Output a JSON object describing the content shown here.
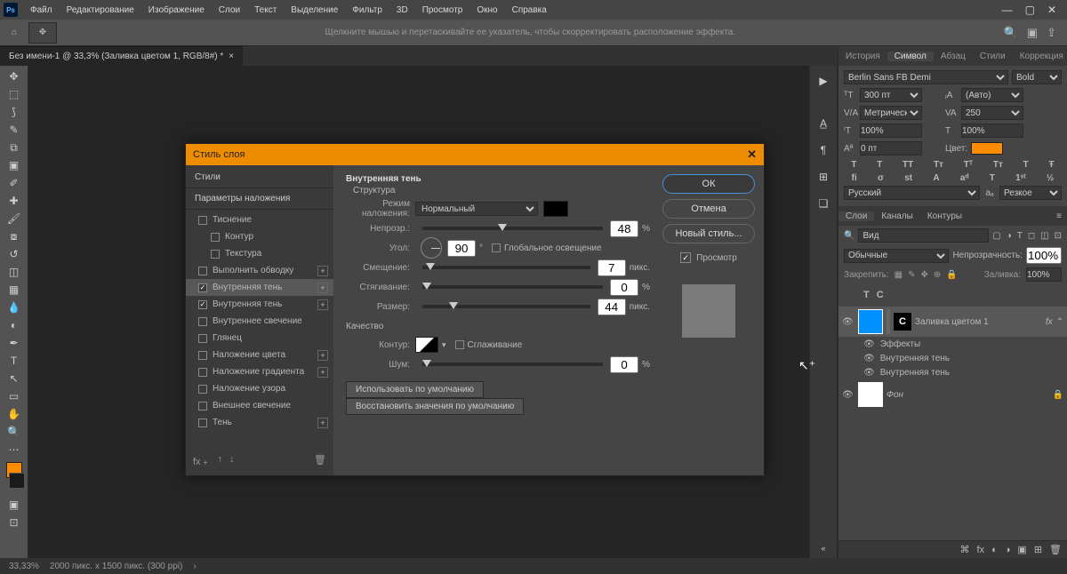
{
  "menu": {
    "items": [
      "Файл",
      "Редактирование",
      "Изображение",
      "Слои",
      "Текст",
      "Выделение",
      "Фильтр",
      "3D",
      "Просмотр",
      "Окно",
      "Справка"
    ]
  },
  "toolbar": {
    "hint": "Щелкните мышью и перетаскивайте ее указатель, чтобы скорректировать расположение эффекта."
  },
  "doc": {
    "tab": "Без имени-1 @ 33,3% (Заливка цветом 1, RGB/8#) *",
    "close": "×"
  },
  "status": {
    "zoom": "33,33%",
    "info": "2000 пикс. x 1500 пикс. (300 ppi)"
  },
  "panels": {
    "tabs1": [
      "История",
      "Символ",
      "Абзац",
      "Стили",
      "Коррекция"
    ],
    "font": "Berlin Sans FB Demi",
    "weight": "Bold",
    "size": "300 пт",
    "leading": "(Авто)",
    "kerning": "Метрически",
    "tracking": "250",
    "vscale": "100%",
    "hscale": "100%",
    "baseline": "0 пт",
    "color_label": "Цвет:",
    "lang": "Русский",
    "aa": "Резкое",
    "styleglyphs": [
      "T",
      "T",
      "TT",
      "Tᴛ",
      "Tᵀ",
      "Tᴛ",
      "T",
      "Ŧ"
    ],
    "otglyphs": [
      "fi",
      "σ",
      "st",
      "A",
      "aᵈ",
      "T",
      "1ˢᵗ",
      "½"
    ]
  },
  "layers": {
    "tabs": [
      "Слои",
      "Каналы",
      "Контуры"
    ],
    "search_label": "Вид",
    "mode": "Обычные",
    "opacity_lab": "Непрозрачность:",
    "opacity": "100%",
    "lock_lab": "Закрепить:",
    "fill_lab": "Заливка:",
    "fill": "100%",
    "typerow": [
      "T",
      "C"
    ],
    "layer1": "Заливка цветом 1",
    "fx": "fx",
    "effects": "Эффекты",
    "inner1": "Внутренняя тень",
    "inner2": "Внутренняя тень",
    "bg": "Фон"
  },
  "dialog": {
    "title": "Стиль слоя",
    "left_header1": "Стили",
    "left_header2": "Параметры наложения",
    "items": [
      {
        "label": "Тиснение",
        "cb": false,
        "plus": false
      },
      {
        "label": "Контур",
        "cb": false,
        "plus": false,
        "indent": true
      },
      {
        "label": "Текстура",
        "cb": false,
        "plus": false,
        "indent": true
      },
      {
        "label": "Выполнить обводку",
        "cb": false,
        "plus": true
      },
      {
        "label": "Внутренняя тень",
        "cb": true,
        "plus": true,
        "active": true
      },
      {
        "label": "Внутренняя тень",
        "cb": true,
        "plus": true
      },
      {
        "label": "Внутреннее свечение",
        "cb": false,
        "plus": false
      },
      {
        "label": "Глянец",
        "cb": false,
        "plus": false
      },
      {
        "label": "Наложение цвета",
        "cb": false,
        "plus": true
      },
      {
        "label": "Наложение градиента",
        "cb": false,
        "plus": true
      },
      {
        "label": "Наложение узора",
        "cb": false,
        "plus": false
      },
      {
        "label": "Внешнее свечение",
        "cb": false,
        "plus": false
      },
      {
        "label": "Тень",
        "cb": false,
        "plus": true
      }
    ],
    "section": "Внутренняя тень",
    "structure": "Структура",
    "blendmode_lab": "Режим наложения:",
    "blendmode": "Нормальный",
    "opacity_lab": "Непрозр.:",
    "opacity": "48",
    "pct": "%",
    "angle_lab": "Угол:",
    "angle": "90",
    "global": "Глобальное освещение",
    "distance_lab": "Смещение:",
    "distance": "7",
    "px": "пикс.",
    "choke_lab": "Стягивание:",
    "choke": "0",
    "size_lab": "Размер:",
    "size": "44",
    "quality": "Качество",
    "contour_lab": "Контур:",
    "aa": "Сглаживание",
    "noise_lab": "Шум:",
    "noise": "0",
    "btn_default": "Использовать по умолчанию",
    "btn_reset": "Восстановить значения по умолчанию",
    "ok": "ОК",
    "cancel": "Отмена",
    "newstyle": "Новый стиль...",
    "preview": "Просмотр"
  }
}
